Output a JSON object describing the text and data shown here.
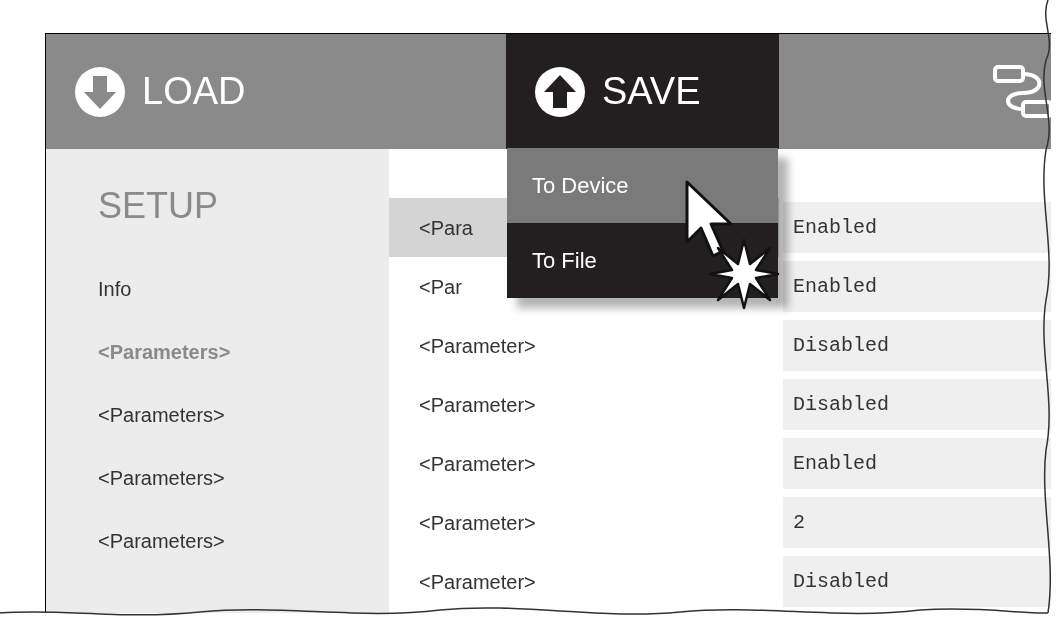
{
  "toolbar": [
    {
      "label": "LOAD",
      "selected": false
    },
    {
      "label": "SAVE",
      "selected": true
    }
  ],
  "save_menu": {
    "items": [
      {
        "label": "To Device",
        "selected": true
      },
      {
        "label": "To File",
        "selected": false
      }
    ]
  },
  "sidebar": {
    "title": "SETUP",
    "items": [
      {
        "label": "Info",
        "selected": false
      },
      {
        "label": "<Parameters>",
        "selected": true
      },
      {
        "label": "<Parameters>",
        "selected": false
      },
      {
        "label": "<Parameters>",
        "selected": false
      },
      {
        "label": "<Parameters>",
        "selected": false
      }
    ]
  },
  "table": {
    "rows": [
      {
        "name": "<Para",
        "value": "Enabled",
        "selected": true
      },
      {
        "name": "<Par",
        "value": "Enabled",
        "selected": false
      },
      {
        "name": "<Parameter>",
        "value": "Disabled",
        "selected": false
      },
      {
        "name": "<Parameter>",
        "value": "Disabled",
        "selected": false
      },
      {
        "name": "<Parameter>",
        "value": "Enabled",
        "selected": false
      },
      {
        "name": "<Parameter>",
        "value": "2",
        "selected": false
      },
      {
        "name": "<Parameter>",
        "value": "Disabled",
        "selected": false
      }
    ]
  }
}
